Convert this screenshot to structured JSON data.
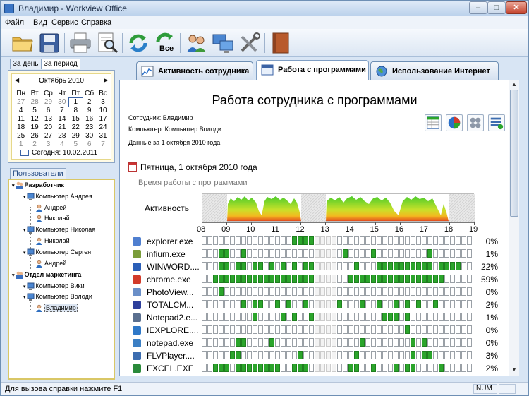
{
  "window": {
    "title": "Владимир - Workview Office"
  },
  "menu": [
    "Файл",
    "Вид",
    "Сервис",
    "Справка"
  ],
  "toolbar_icons": [
    "open-folder-icon",
    "save-icon",
    "print-icon",
    "print-preview-icon",
    "refresh-icon",
    "refresh-all-icon",
    "users-icon",
    "computers-icon",
    "tools-icon",
    "book-icon"
  ],
  "toolbar_refresh_all_label": "Все",
  "left": {
    "date_tabs": [
      "За день",
      "За период"
    ],
    "calendar": {
      "month": "Октябрь 2010",
      "weekdays": [
        "Пн",
        "Вт",
        "Ср",
        "Чт",
        "Пт",
        "Сб",
        "Вс"
      ],
      "weeks": [
        [
          "27",
          "28",
          "29",
          "30",
          "1",
          "2",
          "3"
        ],
        [
          "4",
          "5",
          "6",
          "7",
          "8",
          "9",
          "10"
        ],
        [
          "11",
          "12",
          "13",
          "14",
          "15",
          "16",
          "17"
        ],
        [
          "18",
          "19",
          "20",
          "21",
          "22",
          "23",
          "24"
        ],
        [
          "25",
          "26",
          "27",
          "28",
          "29",
          "30",
          "31"
        ],
        [
          "1",
          "2",
          "3",
          "4",
          "5",
          "6",
          "7"
        ]
      ],
      "today": "Сегодня: 10.02.2011"
    },
    "users_label": "Пользователи",
    "tree": [
      {
        "label": "Разработчик",
        "bold": true
      },
      {
        "label": "Компьютер Андрея"
      },
      {
        "label": "Андрей"
      },
      {
        "label": "Николай"
      },
      {
        "label": "Компьютер Николая"
      },
      {
        "label": "Николай"
      },
      {
        "label": "Компьютер Сергея"
      },
      {
        "label": "Андрей"
      },
      {
        "label": "Отдел маркетинга",
        "bold": true
      },
      {
        "label": "Компьютер Вики"
      },
      {
        "label": "Компьютер Володи"
      },
      {
        "label": "Владимир",
        "selected": true
      }
    ]
  },
  "tabs": [
    "Активность сотрудника",
    "Работа с программами",
    "Использование Интернет"
  ],
  "report": {
    "title": "Работа сотрудника с программами",
    "employee": "Сотрудник:  Владимир",
    "computer": "Компьютер: Компьютер Володи",
    "data_for": "Данные за 1 октября 2010 года.",
    "day": "Пятница,  1 октября 2010 года",
    "section": "Время работы с программами",
    "activity_label": "Активность",
    "hours": [
      "08",
      "09",
      "10",
      "11",
      "12",
      "13",
      "14",
      "15",
      "16",
      "17",
      "18",
      "19"
    ],
    "apps": [
      {
        "name": "explorer.exe",
        "pct": "0%",
        "icon_color": "#4f7fd0",
        "on": [
          27,
          28,
          29,
          30,
          31,
          32,
          33,
          34,
          35,
          36,
          37
        ]
      },
      {
        "name": "infium.exe",
        "pct": "1%",
        "icon_color": "#7a9d3a",
        "on": [
          5,
          6,
          8,
          13,
          42,
          50,
          51,
          68
        ]
      },
      {
        "name": "WINWORD....",
        "pct": "22%",
        "icon_color": "#2b5fb8",
        "on": [
          5,
          6,
          8,
          10,
          11,
          13,
          15,
          16,
          18,
          21,
          24,
          28,
          30,
          32,
          34,
          45,
          53,
          54,
          55,
          56,
          58,
          59,
          60,
          61,
          62,
          63,
          64,
          65,
          68,
          70,
          72,
          74,
          76
        ]
      },
      {
        "name": "chrome.exe",
        "pct": "59%",
        "icon_color": "#d23b2a",
        "on": [
          4,
          5,
          6,
          7,
          8,
          9,
          10,
          11,
          12,
          13,
          14,
          15,
          16,
          17,
          18,
          19,
          20,
          21,
          23,
          24,
          25,
          26,
          27,
          28,
          29,
          30,
          31,
          32,
          33,
          34,
          35,
          36,
          37,
          38,
          39,
          44,
          45,
          46,
          47,
          48,
          49,
          50,
          51,
          52,
          53,
          54,
          55,
          56,
          57,
          58,
          59,
          60,
          61,
          62,
          63,
          64,
          65,
          66,
          67,
          68,
          69,
          70,
          71
        ]
      },
      {
        "name": "PhotoView...",
        "pct": "0%",
        "icon_color": "#6a8fc8",
        "on": [
          5,
          6
        ]
      },
      {
        "name": "TOTALCM...",
        "pct": "2%",
        "icon_color": "#2d3f9c",
        "on": [
          12,
          15,
          18,
          22,
          26,
          30,
          35,
          40,
          47,
          52,
          57,
          60,
          64,
          69
        ]
      },
      {
        "name": "Notepad2.e...",
        "pct": "1%",
        "icon_color": "#5a6f8f",
        "on": [
          15,
          24,
          27,
          33,
          54,
          55,
          58,
          61
        ]
      },
      {
        "name": "IEXPLORE....",
        "pct": "0%",
        "icon_color": "#2f78c8",
        "on": [
          60
        ]
      },
      {
        "name": "notepad.exe",
        "pct": "0%",
        "icon_color": "#3b7fc4",
        "on": [
          10,
          12,
          20,
          37,
          48,
          62,
          66
        ]
      },
      {
        "name": "FLVPlayer....",
        "pct": "3%",
        "icon_color": "#3c6db0",
        "on": [
          9,
          10,
          29,
          39,
          45,
          62,
          63,
          66,
          67,
          68
        ]
      },
      {
        "name": "EXCEL.EXE",
        "pct": "2%",
        "icon_color": "#2a8a3a",
        "on": [
          4,
          5,
          7,
          8,
          10,
          12,
          13,
          14,
          15,
          16,
          17,
          19,
          21,
          23,
          27,
          29,
          31,
          36,
          38,
          44,
          46,
          51,
          57,
          60,
          63,
          71
        ]
      }
    ]
  },
  "status": {
    "text": "Для вызова справки нажмите F1",
    "num": "NUM"
  }
}
